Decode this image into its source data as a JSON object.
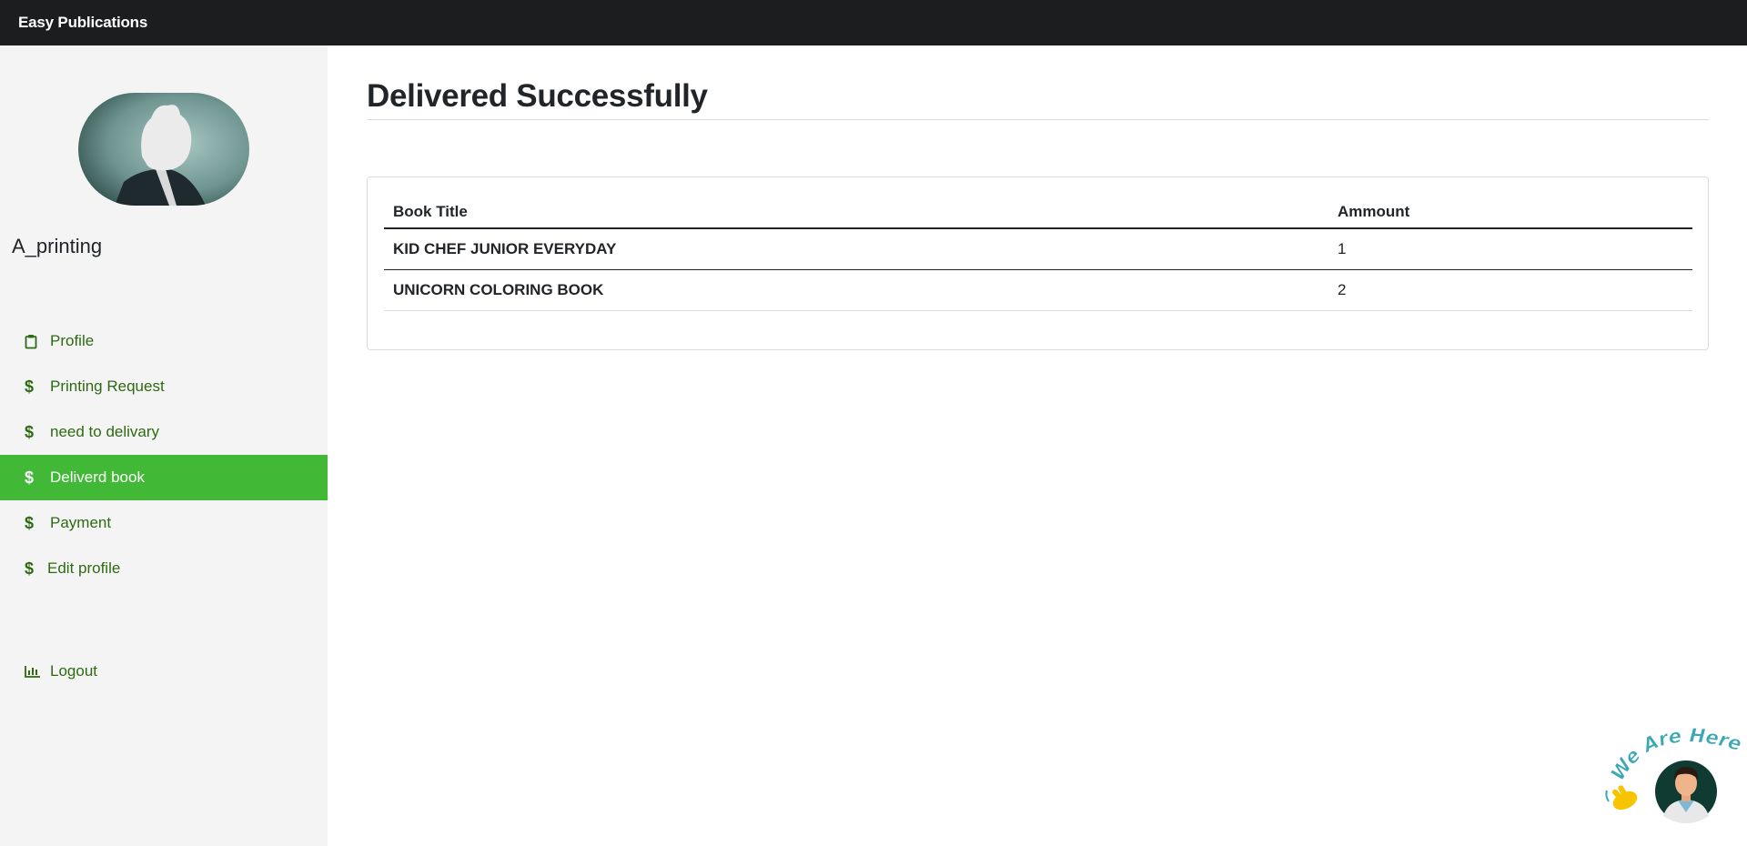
{
  "app": {
    "brand": "Easy Publications"
  },
  "sidebar": {
    "username": "A_printing",
    "items": [
      {
        "label": "Profile",
        "icon": "clipboard-icon"
      },
      {
        "label": "Printing Request",
        "icon": "dollar-icon"
      },
      {
        "label": "need to delivary",
        "icon": "dollar-icon"
      },
      {
        "label": "Deliverd book",
        "icon": "dollar-icon",
        "active": true
      },
      {
        "label": "Payment",
        "icon": "dollar-icon"
      },
      {
        "label": "Edit profile",
        "icon": "dollar-icon"
      }
    ],
    "logout": {
      "label": "Logout",
      "icon": "bar-chart-icon"
    }
  },
  "main": {
    "title": "Delivered Successfully",
    "table": {
      "headers": [
        "Book Title",
        "Ammount"
      ],
      "rows": [
        [
          "KID CHEF JUNIOR EVERYDAY",
          "1"
        ],
        [
          "UNICORN COLORING BOOK",
          "2"
        ]
      ]
    }
  },
  "chat_widget": {
    "text": "We Are Here!",
    "icon": "waving-hand-icon"
  },
  "colors": {
    "accent": "#42b837",
    "nav_text": "#2d6a12",
    "topbar": "#1c1d1f",
    "sidebar_bg": "#f4f4f4"
  }
}
